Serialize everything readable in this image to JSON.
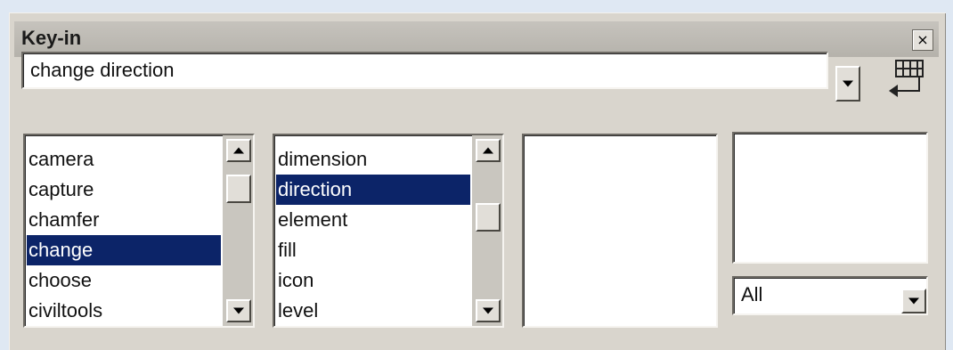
{
  "window": {
    "title": "Key-in",
    "close_glyph": "×"
  },
  "keyin": {
    "value": "change direction"
  },
  "list1": {
    "items": [
      "camera",
      "capture",
      "chamfer",
      "change",
      "choose",
      "civiltools"
    ],
    "selected_index": 3
  },
  "list2": {
    "items": [
      "dimension",
      "direction",
      "element",
      "fill",
      "icon",
      "level"
    ],
    "selected_index": 1
  },
  "list3": {
    "items": []
  },
  "list4": {
    "items": []
  },
  "filter": {
    "value": "All"
  },
  "colors": {
    "selection": "#0c2468",
    "panel": "#d9d5cd",
    "titlebar": "#bbb8b1"
  },
  "icons": {
    "keyin_enter": "keyboard-enter-icon"
  }
}
